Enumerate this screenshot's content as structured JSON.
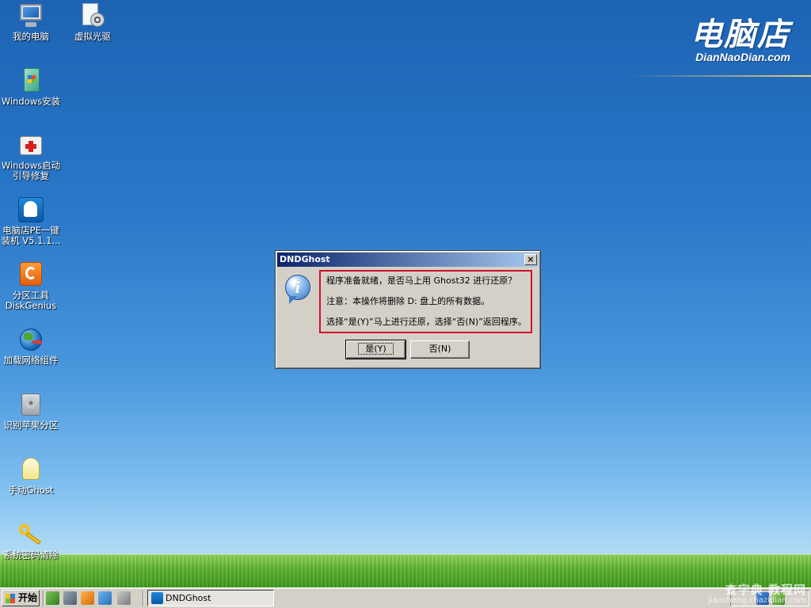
{
  "desktop": {
    "icons": [
      {
        "label": "我的电脑",
        "icon": "computer-icon"
      },
      {
        "label": "虚拟光驱",
        "icon": "virtual-cd-icon"
      },
      {
        "label": "Windows安装",
        "icon": "windows-setup-icon"
      },
      {
        "label": "Windows启动\n引导修复",
        "icon": "boot-repair-icon"
      },
      {
        "label": "电脑店PE一键\n装机 V5.1.1...",
        "icon": "dndghost-icon"
      },
      {
        "label": "分区工具\nDiskGenius",
        "icon": "diskgenius-icon"
      },
      {
        "label": "加载网络组件",
        "icon": "network-globe-icon"
      },
      {
        "label": "识别苹果分区",
        "icon": "hard-disk-icon"
      },
      {
        "label": "手动Ghost",
        "icon": "ghost-icon"
      },
      {
        "label": "系统密码清除",
        "icon": "key-icon"
      }
    ],
    "logo": {
      "cn": "电脑店",
      "en": "DianNaoDian.com"
    }
  },
  "dialog": {
    "title": "DNDGhost",
    "close_glyph": "×",
    "lines": [
      "程序准备就绪，是否马上用 Ghost32 进行还原？",
      "注意：本操作将删除 D: 盘上的所有数据。",
      "选择“是(Y)”马上进行还原，选择“否(N)”返回程序。"
    ],
    "highlight_color": "#d0102a",
    "yes_button": "是(Y)",
    "no_button": "否(N)"
  },
  "taskbar": {
    "start_label": "开始",
    "task_label": "DNDGhost"
  },
  "watermark": {
    "line1": "查字典 教程网",
    "line2": "jiaocheng.chazidian.com"
  }
}
